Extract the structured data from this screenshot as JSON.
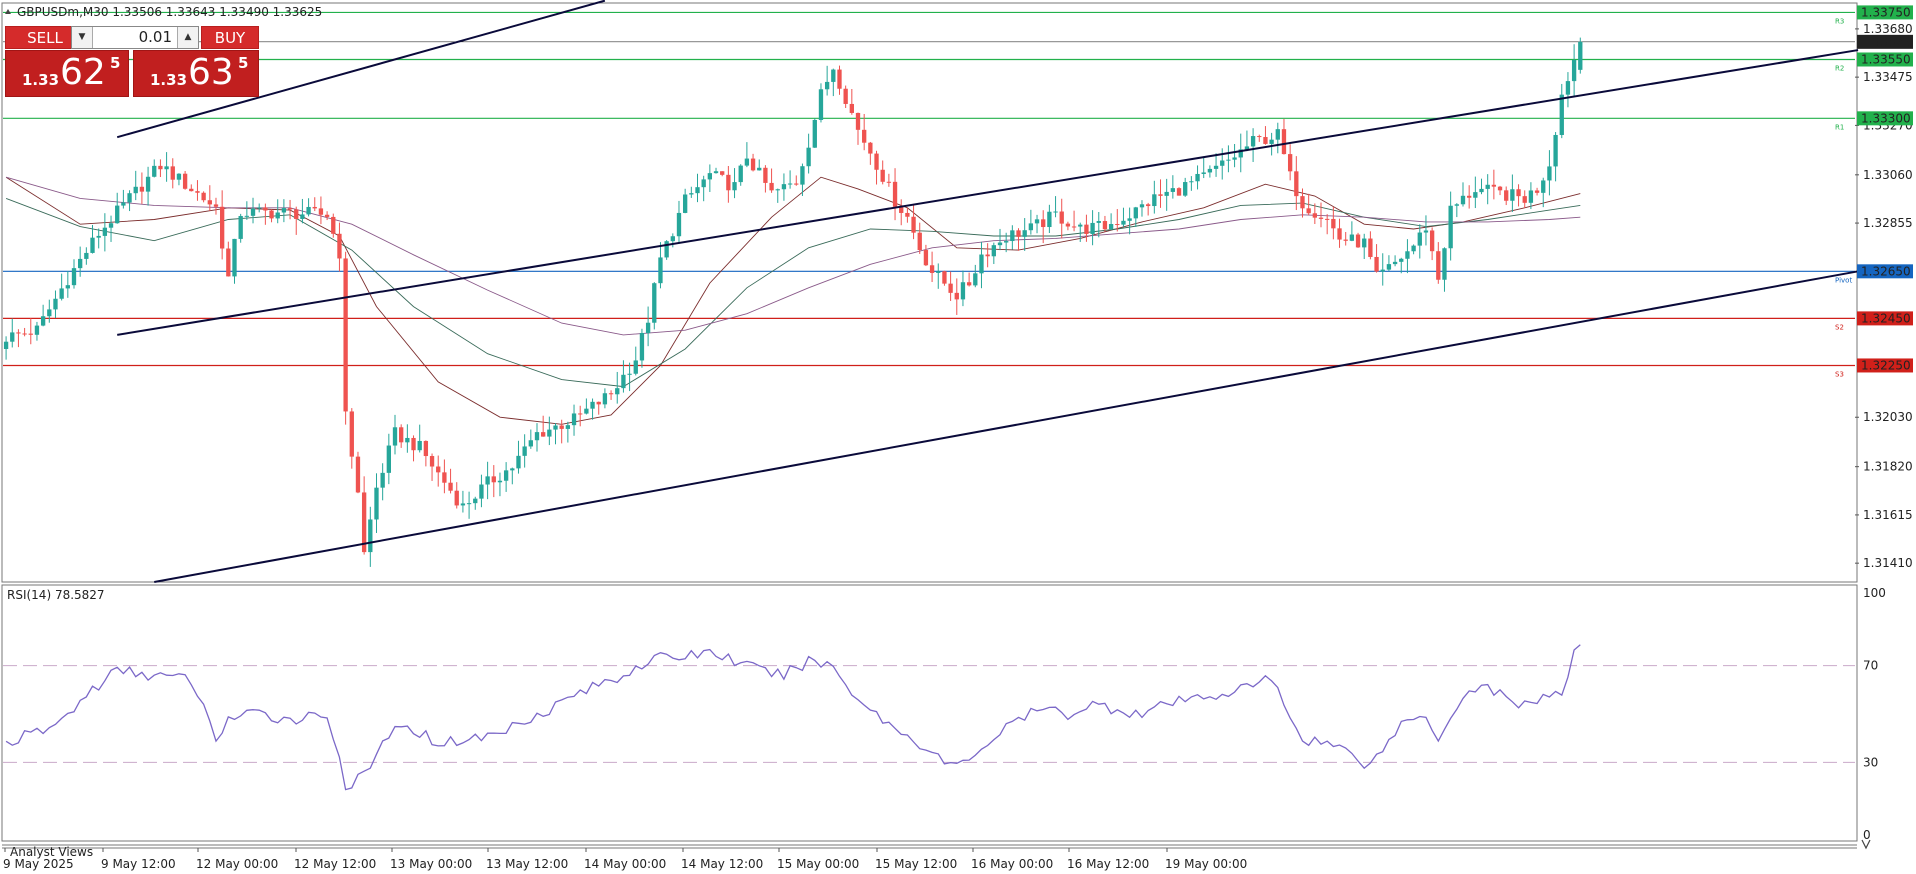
{
  "window": {
    "symbol_info": "GBPUSDm,M30  1.33506 1.33643 1.33490 1.33625"
  },
  "trade_panel": {
    "sell_label": "SELL",
    "buy_label": "BUY",
    "lot": "0.01",
    "sell_prefix": "1.33",
    "sell_big": "62",
    "sell_sup": "5",
    "buy_prefix": "1.33",
    "buy_big": "63",
    "buy_sup": "5"
  },
  "rsi_label": "RSI(14) 78.5827",
  "bottom_tab": "Analyst Views",
  "colors": {
    "bull": "#26a69a",
    "bear": "#ef5350",
    "resistance": "#22b14c",
    "pivot": "#1565c0",
    "support": "#d0201a",
    "bid": "#333333",
    "trade_button": "#d52b2b",
    "rsi_line": "#7b68c8",
    "rsi_levels": "#c9a9c9",
    "channel": "#0a0a3a",
    "ma_fast": "#7b2d2d",
    "ma_mid": "#3a6b5a",
    "ma_slow": "#8a5a8a"
  },
  "chart_data": {
    "type": "candlestick",
    "symbol": "GBPUSDm",
    "timeframe": "M30",
    "ohlc_header": {
      "open": 1.33506,
      "high": 1.33643,
      "low": 1.3349,
      "close": 1.33625
    },
    "price_ticks": [
      "1.33680",
      "1.33475",
      "1.33270",
      "1.33060",
      "1.32855",
      "1.32030",
      "1.31820",
      "1.31615",
      "1.31410"
    ],
    "ylim": [
      1.3133,
      1.3379
    ],
    "x_labels": [
      "9 May 2025",
      "9 May 12:00",
      "12 May 00:00",
      "12 May 12:00",
      "13 May 00:00",
      "13 May 12:00",
      "14 May 00:00",
      "14 May 12:00",
      "15 May 00:00",
      "15 May 12:00",
      "16 May 00:00",
      "16 May 12:00",
      "19 May 00:00"
    ],
    "levels": [
      {
        "value": 1.3375,
        "label": "1.33750",
        "tag": "R3",
        "kind": "resistance"
      },
      {
        "value": 1.33625,
        "label": "1.33625",
        "tag": "",
        "kind": "bid"
      },
      {
        "value": 1.3355,
        "label": "1.33550",
        "tag": "R2",
        "kind": "resistance"
      },
      {
        "value": 1.333,
        "label": "1.33300",
        "tag": "R1",
        "kind": "resistance"
      },
      {
        "value": 1.3265,
        "label": "1.32650",
        "tag": "Pivot",
        "kind": "pivot"
      },
      {
        "value": 1.3245,
        "label": "1.32450",
        "tag": "S2",
        "kind": "support"
      },
      {
        "value": 1.3225,
        "label": "1.32250",
        "tag": "S3",
        "kind": "support"
      }
    ],
    "candle_close_path": [
      [
        0,
        1.3237
      ],
      [
        5,
        1.324
      ],
      [
        10,
        1.3262
      ],
      [
        15,
        1.3281
      ],
      [
        20,
        1.3296
      ],
      [
        25,
        1.331
      ],
      [
        30,
        1.33
      ],
      [
        34,
        1.3292
      ],
      [
        36,
        1.3262
      ],
      [
        38,
        1.329
      ],
      [
        45,
        1.329
      ],
      [
        52,
        1.3289
      ],
      [
        54,
        1.3273
      ],
      [
        55,
        1.3203
      ],
      [
        57,
        1.3172
      ],
      [
        58,
        1.3145
      ],
      [
        60,
        1.3173
      ],
      [
        63,
        1.3196
      ],
      [
        67,
        1.319
      ],
      [
        70,
        1.3179
      ],
      [
        74,
        1.3165
      ],
      [
        78,
        1.3175
      ],
      [
        82,
        1.3182
      ],
      [
        86,
        1.3196
      ],
      [
        92,
        1.3202
      ],
      [
        98,
        1.3213
      ],
      [
        102,
        1.3228
      ],
      [
        104,
        1.3245
      ],
      [
        106,
        1.327
      ],
      [
        110,
        1.3295
      ],
      [
        114,
        1.3306
      ],
      [
        118,
        1.3301
      ],
      [
        120,
        1.3314
      ],
      [
        124,
        1.3298
      ],
      [
        128,
        1.3303
      ],
      [
        130,
        1.332
      ],
      [
        132,
        1.334
      ],
      [
        134,
        1.3352
      ],
      [
        136,
        1.3339
      ],
      [
        138,
        1.3325
      ],
      [
        140,
        1.3316
      ],
      [
        144,
        1.3295
      ],
      [
        146,
        1.3288
      ],
      [
        148,
        1.3275
      ],
      [
        150,
        1.3265
      ],
      [
        154,
        1.3255
      ],
      [
        156,
        1.326
      ],
      [
        158,
        1.3272
      ],
      [
        162,
        1.328
      ],
      [
        166,
        1.3283
      ],
      [
        170,
        1.3289
      ],
      [
        174,
        1.3283
      ],
      [
        178,
        1.3284
      ],
      [
        182,
        1.3289
      ],
      [
        186,
        1.3296
      ],
      [
        190,
        1.33
      ],
      [
        194,
        1.3305
      ],
      [
        198,
        1.3312
      ],
      [
        202,
        1.332
      ],
      [
        206,
        1.3323
      ],
      [
        208,
        1.3305
      ],
      [
        210,
        1.3294
      ],
      [
        214,
        1.3287
      ],
      [
        216,
        1.3279
      ],
      [
        220,
        1.3277
      ],
      [
        222,
        1.3262
      ],
      [
        224,
        1.3266
      ],
      [
        228,
        1.3276
      ],
      [
        230,
        1.3284
      ],
      [
        232,
        1.3262
      ],
      [
        234,
        1.3291
      ],
      [
        238,
        1.33
      ],
      [
        242,
        1.3298
      ],
      [
        246,
        1.3296
      ],
      [
        248,
        1.33
      ],
      [
        250,
        1.3311
      ],
      [
        252,
        1.334
      ],
      [
        254,
        1.3355
      ],
      [
        255,
        1.33625
      ]
    ],
    "rsi": {
      "period": 14,
      "value": 78.5827,
      "levels": [
        30,
        70
      ],
      "ylim": [
        0,
        100
      ],
      "ticks": [
        "100",
        "70",
        "30",
        "0"
      ],
      "path": [
        [
          0,
          38
        ],
        [
          8,
          45
        ],
        [
          14,
          60
        ],
        [
          18,
          68
        ],
        [
          24,
          66
        ],
        [
          30,
          64
        ],
        [
          34,
          40
        ],
        [
          36,
          48
        ],
        [
          40,
          50
        ],
        [
          46,
          48
        ],
        [
          52,
          50
        ],
        [
          54,
          32
        ],
        [
          55,
          20
        ],
        [
          58,
          24
        ],
        [
          62,
          42
        ],
        [
          66,
          44
        ],
        [
          70,
          38
        ],
        [
          76,
          40
        ],
        [
          80,
          42
        ],
        [
          84,
          48
        ],
        [
          88,
          52
        ],
        [
          92,
          58
        ],
        [
          96,
          62
        ],
        [
          100,
          66
        ],
        [
          102,
          70
        ],
        [
          106,
          73
        ],
        [
          110,
          74
        ],
        [
          114,
          76
        ],
        [
          118,
          72
        ],
        [
          122,
          68
        ],
        [
          126,
          66
        ],
        [
          130,
          72
        ],
        [
          134,
          70
        ],
        [
          136,
          62
        ],
        [
          140,
          52
        ],
        [
          144,
          44
        ],
        [
          148,
          38
        ],
        [
          152,
          30
        ],
        [
          154,
          28
        ],
        [
          156,
          32
        ],
        [
          160,
          40
        ],
        [
          164,
          48
        ],
        [
          168,
          52
        ],
        [
          172,
          50
        ],
        [
          176,
          54
        ],
        [
          180,
          52
        ],
        [
          184,
          50
        ],
        [
          188,
          54
        ],
        [
          192,
          56
        ],
        [
          196,
          58
        ],
        [
          200,
          60
        ],
        [
          204,
          64
        ],
        [
          206,
          62
        ],
        [
          208,
          48
        ],
        [
          210,
          40
        ],
        [
          214,
          38
        ],
        [
          218,
          34
        ],
        [
          220,
          30
        ],
        [
          222,
          32
        ],
        [
          226,
          46
        ],
        [
          230,
          50
        ],
        [
          232,
          40
        ],
        [
          236,
          58
        ],
        [
          240,
          62
        ],
        [
          244,
          54
        ],
        [
          248,
          56
        ],
        [
          252,
          58
        ],
        [
          254,
          74
        ],
        [
          255,
          78.58
        ]
      ]
    },
    "moving_averages": [
      {
        "kind": "fast",
        "path": [
          [
            0,
            1.3305
          ],
          [
            12,
            1.3285
          ],
          [
            24,
            1.3287
          ],
          [
            36,
            1.3292
          ],
          [
            46,
            1.3291
          ],
          [
            54,
            1.328
          ],
          [
            60,
            1.325
          ],
          [
            70,
            1.3218
          ],
          [
            80,
            1.3203
          ],
          [
            90,
            1.32
          ],
          [
            98,
            1.3204
          ],
          [
            106,
            1.3225
          ],
          [
            114,
            1.326
          ],
          [
            124,
            1.3288
          ],
          [
            132,
            1.3305
          ],
          [
            138,
            1.33
          ],
          [
            146,
            1.3292
          ],
          [
            154,
            1.3275
          ],
          [
            164,
            1.3274
          ],
          [
            174,
            1.3279
          ],
          [
            184,
            1.3286
          ],
          [
            194,
            1.3292
          ],
          [
            204,
            1.3302
          ],
          [
            212,
            1.3297
          ],
          [
            220,
            1.3285
          ],
          [
            228,
            1.3283
          ],
          [
            236,
            1.3286
          ],
          [
            246,
            1.3292
          ],
          [
            255,
            1.3298
          ]
        ]
      },
      {
        "kind": "mid",
        "path": [
          [
            0,
            1.3296
          ],
          [
            12,
            1.3284
          ],
          [
            24,
            1.3278
          ],
          [
            36,
            1.3287
          ],
          [
            46,
            1.3289
          ],
          [
            56,
            1.3274
          ],
          [
            66,
            1.325
          ],
          [
            78,
            1.323
          ],
          [
            90,
            1.3219
          ],
          [
            100,
            1.3216
          ],
          [
            110,
            1.3232
          ],
          [
            120,
            1.3258
          ],
          [
            130,
            1.3275
          ],
          [
            140,
            1.3283
          ],
          [
            150,
            1.3282
          ],
          [
            160,
            1.328
          ],
          [
            170,
            1.328
          ],
          [
            180,
            1.3283
          ],
          [
            190,
            1.3287
          ],
          [
            200,
            1.3293
          ],
          [
            210,
            1.3294
          ],
          [
            220,
            1.3288
          ],
          [
            230,
            1.3284
          ],
          [
            240,
            1.3287
          ],
          [
            250,
            1.3291
          ],
          [
            255,
            1.3293
          ]
        ]
      },
      {
        "kind": "slow",
        "path": [
          [
            0,
            1.3305
          ],
          [
            12,
            1.3296
          ],
          [
            24,
            1.3293
          ],
          [
            36,
            1.3292
          ],
          [
            46,
            1.3292
          ],
          [
            56,
            1.3285
          ],
          [
            66,
            1.3272
          ],
          [
            78,
            1.3257
          ],
          [
            90,
            1.3243
          ],
          [
            100,
            1.3238
          ],
          [
            110,
            1.324
          ],
          [
            120,
            1.3247
          ],
          [
            130,
            1.3258
          ],
          [
            140,
            1.3268
          ],
          [
            150,
            1.3275
          ],
          [
            160,
            1.3278
          ],
          [
            170,
            1.3279
          ],
          [
            180,
            1.3281
          ],
          [
            190,
            1.3283
          ],
          [
            200,
            1.3287
          ],
          [
            210,
            1.3289
          ],
          [
            220,
            1.3288
          ],
          [
            230,
            1.3286
          ],
          [
            240,
            1.3286
          ],
          [
            250,
            1.3287
          ],
          [
            255,
            1.3288
          ]
        ]
      }
    ],
    "channel_lines": [
      {
        "from": [
          18,
          1.3322
        ],
        "to": [
          97,
          1.338
        ]
      },
      {
        "from": [
          18,
          1.3238
        ],
        "to": [
          300,
          1.3359
        ]
      },
      {
        "from": [
          24,
          1.3133
        ],
        "to": [
          300,
          1.3265
        ]
      }
    ]
  }
}
